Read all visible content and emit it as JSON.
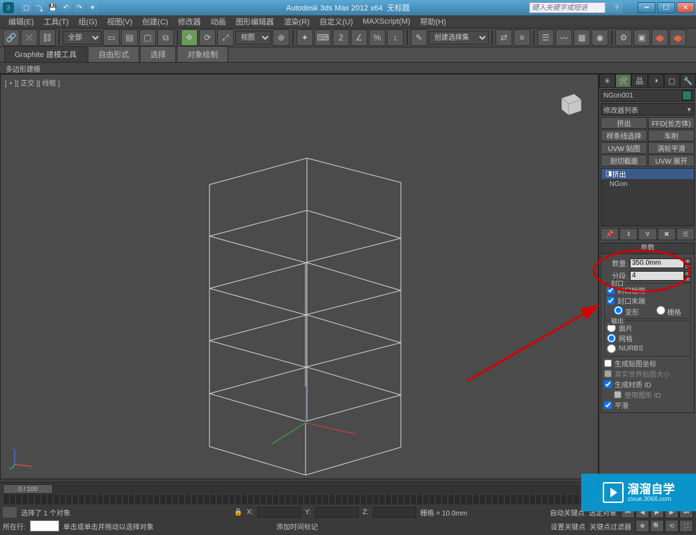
{
  "title": {
    "app": "Autodesk 3ds Max 2012 x64",
    "doc": "无标题"
  },
  "search_placeholder": "键入关键字或短语",
  "menu": [
    "编辑(E)",
    "工具(T)",
    "组(G)",
    "视图(V)",
    "创建(C)",
    "修改器",
    "动画",
    "图形编辑器",
    "渲染(R)",
    "自定义(U)",
    "MAXScript(M)",
    "帮助(H)"
  ],
  "toolbar_all": "全部",
  "toolbar_view": "视图",
  "toolbar_selset": "创建选择集",
  "ribbon": {
    "tabs": [
      "Graphite 建模工具",
      "自由形式",
      "选择",
      "对象绘制"
    ],
    "sub": "多边形建模"
  },
  "viewport_label": "[ + ][ 正交 ][ 线框 ]",
  "cmd": {
    "object_name": "NGon001",
    "modifier_list": "修改器列表",
    "mod_buttons": [
      "挤出",
      "FFD(长方体)",
      "样条线选择",
      "车削",
      "UVW 贴图",
      "涡轮平滑",
      "剖切截面",
      "UVW 展开"
    ],
    "stack": [
      "挤出",
      "NGon"
    ],
    "params_header": "参数",
    "amount_label": "数量:",
    "amount_value": "350.0mm",
    "segments_label": "分段:",
    "segments_value": "4",
    "cap_group": "封口",
    "cap_start": "封口始端",
    "cap_end": "封口末端",
    "morph": "变形",
    "grid": "栅格",
    "output_group": "输出",
    "patch": "面片",
    "mesh": "网格",
    "nurbs": "NURBS",
    "gen_mapping": "生成贴图坐标",
    "real_world": "真实世界贴图大小",
    "gen_matid": "生成材质 ID",
    "use_shape": "使用图形 ID",
    "smooth": "平滑"
  },
  "time": {
    "frame": "0 / 100"
  },
  "status": {
    "sel": "选择了 1 个对象",
    "hint": "单击或单击并拖动以选择对象",
    "x": "X:",
    "y": "Y:",
    "z": "Z:",
    "grid": "栅格 = 10.0mm",
    "autokey": "自动关键点",
    "selset": "选定对象",
    "addtime": "添加时间标记",
    "location": "所在行:",
    "setkey": "设置关键点",
    "keyfilter": "关键点过滤器"
  },
  "watermark": {
    "brand": "溜溜自学",
    "url": "zixue.3066.com"
  }
}
